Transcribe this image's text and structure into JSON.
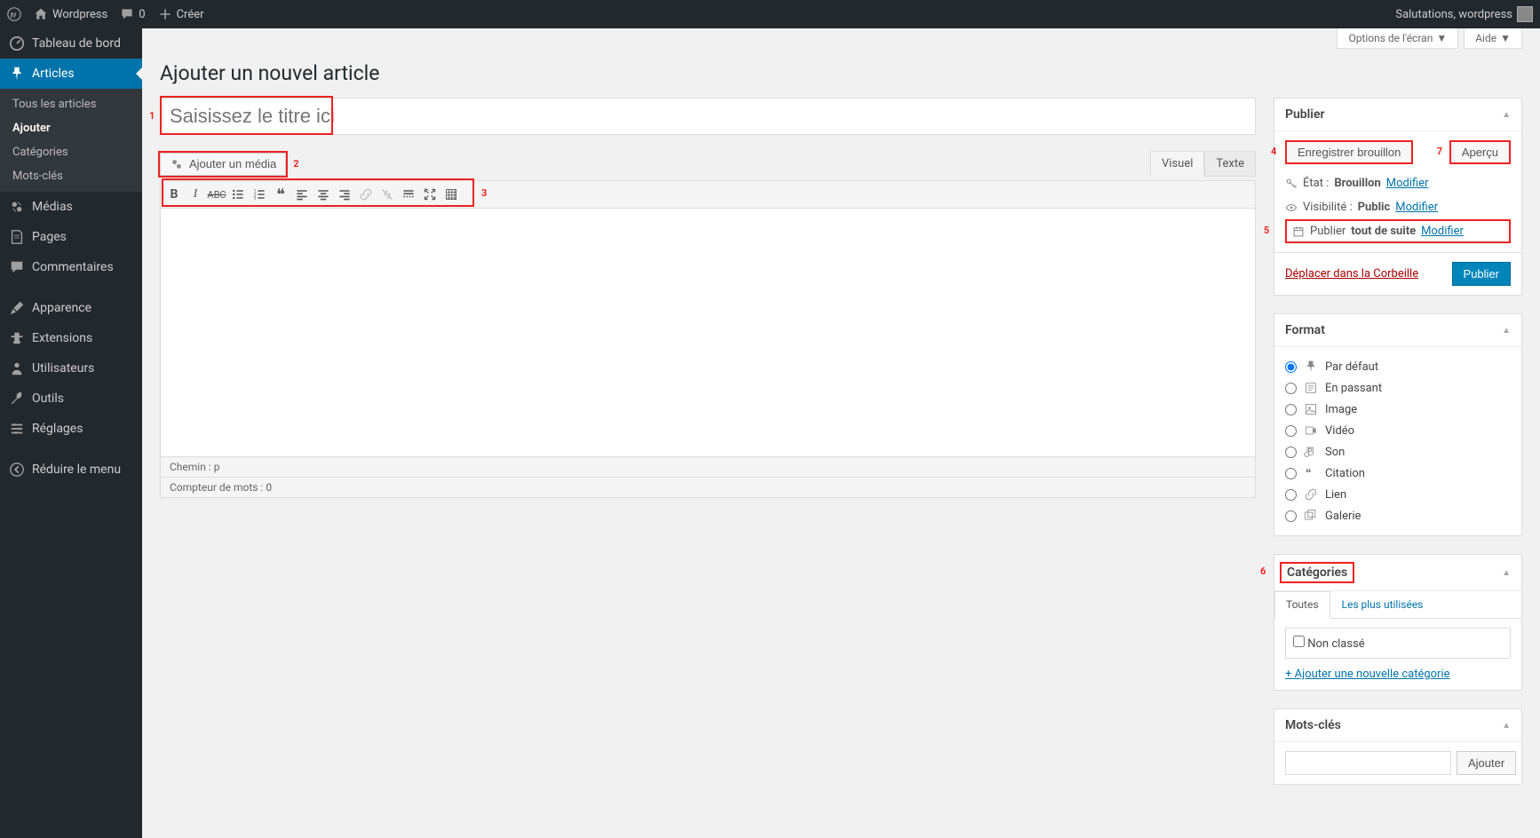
{
  "adminbar": {
    "site_name": "Wordpress",
    "comments_count": "0",
    "create": "Créer",
    "greeting": "Salutations, wordpress"
  },
  "sidebar": {
    "dashboard": "Tableau de bord",
    "articles": "Articles",
    "articles_sub": {
      "all": "Tous les articles",
      "add": "Ajouter",
      "categories": "Catégories",
      "tags": "Mots-clés"
    },
    "media": "Médias",
    "pages": "Pages",
    "comments": "Commentaires",
    "appearance": "Apparence",
    "extensions": "Extensions",
    "users": "Utilisateurs",
    "tools": "Outils",
    "settings": "Réglages",
    "collapse": "Réduire le menu"
  },
  "screen_meta": {
    "options": "Options de l'écran",
    "help": "Aide"
  },
  "page": {
    "title": "Ajouter un nouvel article",
    "title_placeholder": "Saisissez le titre ici",
    "add_media": "Ajouter un média",
    "tab_visual": "Visuel",
    "tab_text": "Texte",
    "path_label": "Chemin : p",
    "word_count": "Compteur de mots : 0"
  },
  "publish": {
    "heading": "Publier",
    "save_draft": "Enregistrer brouillon",
    "preview": "Aperçu",
    "state_label": "État :",
    "state_value": "Brouillon",
    "visibility_label": "Visibilité :",
    "visibility_value": "Public",
    "publish_label": "Publier",
    "publish_value": "tout de suite",
    "edit": "Modifier",
    "trash": "Déplacer dans la Corbeille",
    "submit": "Publier"
  },
  "format": {
    "heading": "Format",
    "options": {
      "defaut": "Par défaut",
      "aside": "En passant",
      "image": "Image",
      "video": "Vidéo",
      "audio": "Son",
      "quote": "Citation",
      "link": "Lien",
      "gallery": "Galerie"
    }
  },
  "categories": {
    "heading": "Catégories",
    "tab_all": "Toutes",
    "tab_popular": "Les plus utilisées",
    "cat_default": "Non classé",
    "add_new": "+ Ajouter une nouvelle catégorie"
  },
  "tags": {
    "heading": "Mots-clés",
    "add_btn": "Ajouter"
  },
  "annotations": {
    "n1": "1",
    "n2": "2",
    "n3": "3",
    "n4": "4",
    "n5": "5",
    "n6": "6",
    "n7": "7"
  }
}
